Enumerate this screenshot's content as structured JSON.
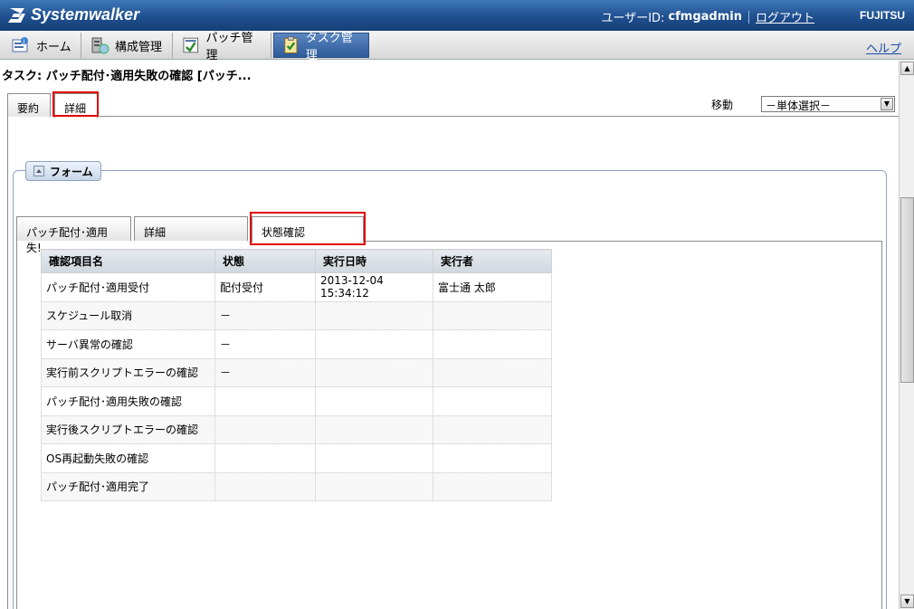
{
  "header": {
    "logo_text": "Systemwalker",
    "user_label": "ユーザーID:",
    "user_id": "cfmgadmin",
    "logout": "ログアウト",
    "brand": "FUJITSU"
  },
  "nav": {
    "items": [
      {
        "label": "ホーム",
        "icon": "home-icon"
      },
      {
        "label": "構成管理",
        "icon": "server-icon"
      },
      {
        "label": "パッチ管理",
        "icon": "patch-icon"
      },
      {
        "label": "タスク管理",
        "icon": "task-icon",
        "active": true
      }
    ],
    "help": "ヘルプ"
  },
  "page": {
    "title": "タスク: パッチ配付･適用失敗の確認 [パッチ...",
    "tabs": [
      "要約",
      "詳細"
    ],
    "move_label": "移動",
    "move_select": "－単体選択－"
  },
  "form": {
    "legend": "フォーム",
    "tabs": [
      "パッチ配付･適用失!",
      "詳細",
      "状態確認"
    ]
  },
  "table": {
    "headers": [
      "確認項目名",
      "状態",
      "実行日時",
      "実行者"
    ],
    "rows": [
      [
        "パッチ配付･適用受付",
        "配付受付",
        "2013-12-04 15:34:12",
        "富士通 太郎"
      ],
      [
        "スケジュール取消",
        "－",
        "",
        ""
      ],
      [
        "サーバ異常の確認",
        "－",
        "",
        ""
      ],
      [
        "実行前スクリプトエラーの確認",
        "－",
        "",
        ""
      ],
      [
        "パッチ配付･適用失敗の確認",
        "",
        "",
        ""
      ],
      [
        "実行後スクリプトエラーの確認",
        "",
        "",
        ""
      ],
      [
        "OS再起動失敗の確認",
        "",
        "",
        ""
      ],
      [
        "パッチ配付･適用完了",
        "",
        "",
        ""
      ]
    ]
  },
  "colors": {
    "header_blue": "#1f4f8f",
    "highlight_red": "#e00000",
    "active_tab": "#2d5b99"
  }
}
